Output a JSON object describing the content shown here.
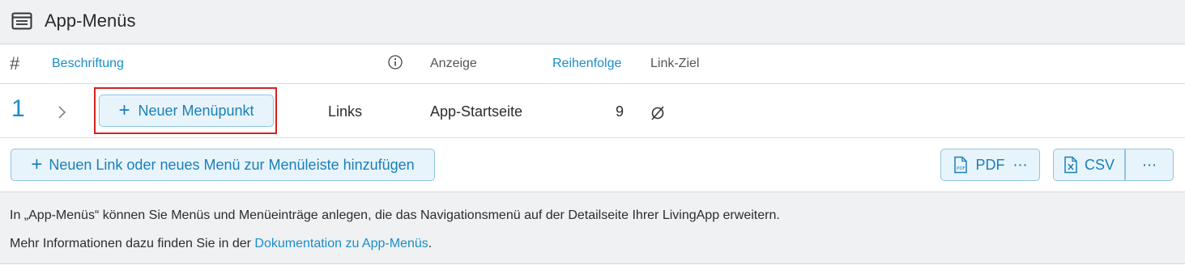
{
  "header": {
    "title": "App-Menüs",
    "icon": "menu-list-icon"
  },
  "columns": {
    "hash": "#",
    "label": "Beschriftung",
    "info_icon": "info-icon",
    "display": "Anzeige",
    "order": "Reihenfolge",
    "link_target": "Link-Ziel"
  },
  "rows": [
    {
      "number": "1",
      "new_item_label": "Neuer Menüpunkt",
      "position": "Links",
      "display": "App-Startseite",
      "order": "9",
      "link_target_icon": "empty-set-icon"
    }
  ],
  "actions": {
    "add_label": "Neuen Link oder neues Menü zur Menüleiste hinzufügen",
    "pdf_label": "PDF",
    "pdf_more": "⋯",
    "csv_label": "CSV",
    "csv_more": "⋯"
  },
  "footer": {
    "line1": "In „App-Menüs“ können Sie Menüs und Menüeinträge anlegen, die das Navigationsmenü auf der Detailseite Ihrer LivingApp erweitern.",
    "line2_prefix": "Mehr Informationen dazu finden Sie in der ",
    "line2_link": "Dokumentation zu App-Menüs",
    "line2_suffix": "."
  },
  "colors": {
    "accent": "#1a8dc9",
    "highlight": "#d32020",
    "button_bg": "#e8f4fb"
  }
}
